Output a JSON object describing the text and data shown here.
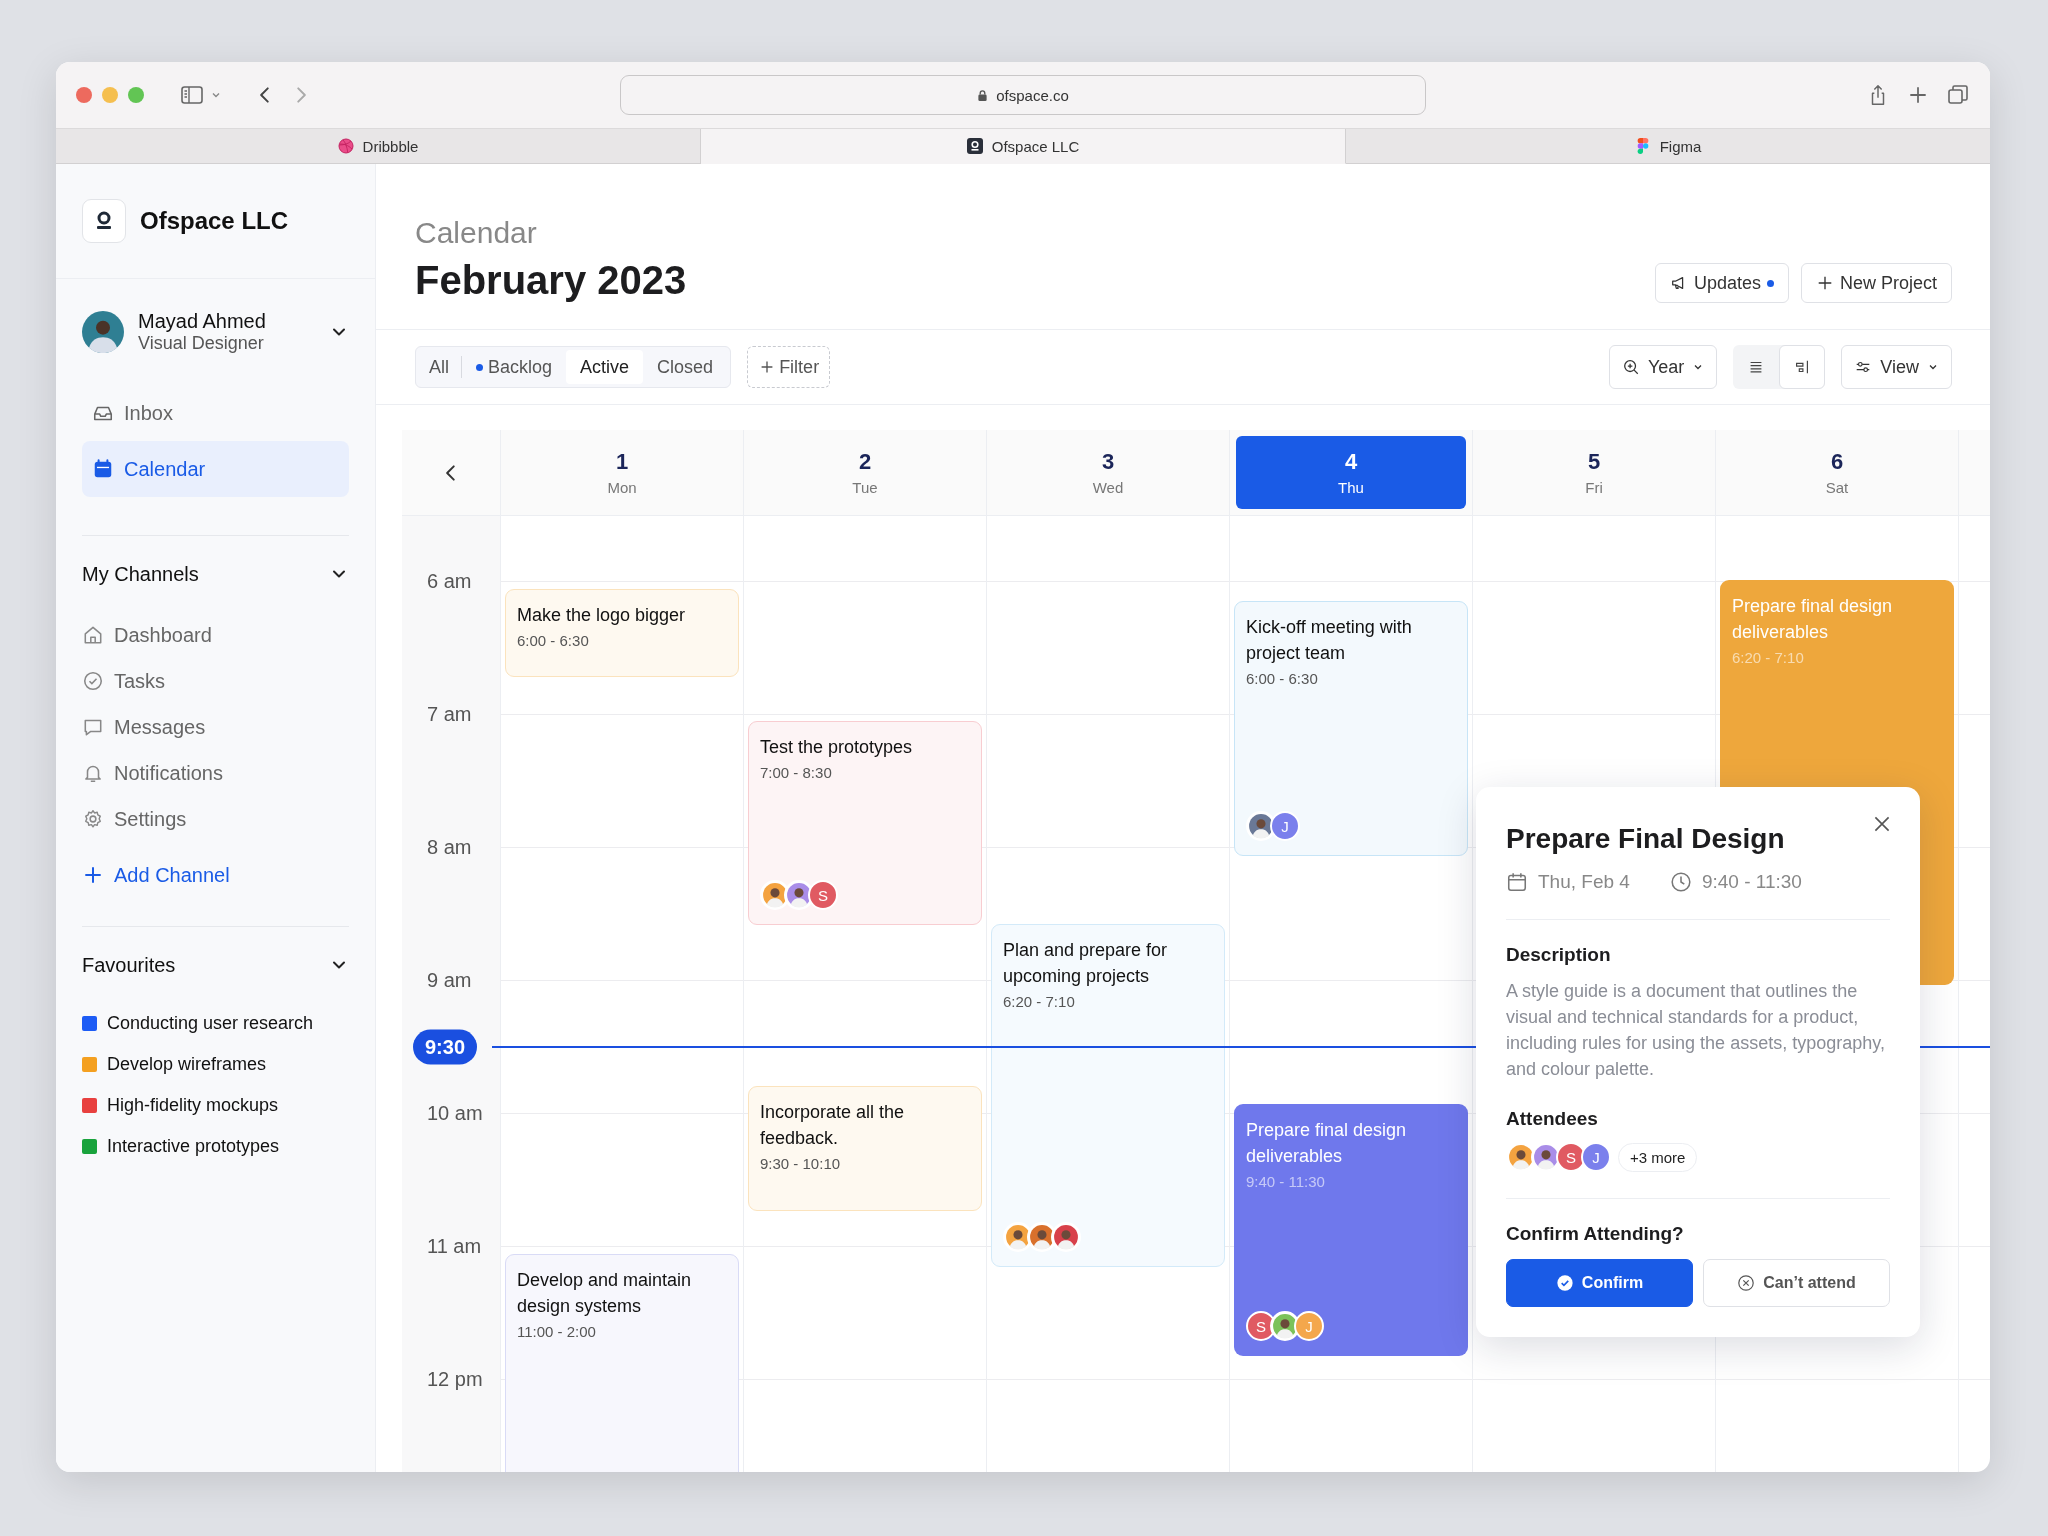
{
  "browser": {
    "url": "ofspace.co",
    "tabs": [
      {
        "label": "Dribbble",
        "selected": false
      },
      {
        "label": "Ofspace LLC",
        "selected": true
      },
      {
        "label": "Figma",
        "selected": false
      }
    ]
  },
  "sidebar": {
    "brand": "Ofspace LLC",
    "user": {
      "name": "Mayad Ahmed",
      "role": "Visual Designer"
    },
    "nav": [
      {
        "label": "Inbox",
        "selected": false
      },
      {
        "label": "Calendar",
        "selected": true
      }
    ],
    "channels": {
      "title": "My Channels",
      "expanded": true,
      "items": [
        "Dashboard",
        "Tasks",
        "Messages",
        "Notifications",
        "Settings"
      ],
      "add": "Add Channel"
    },
    "favourites": {
      "title": "Favourites",
      "expanded": true,
      "items": [
        {
          "label": "Conducting user research",
          "color": "#1d5cf5"
        },
        {
          "label": "Develop wireframes",
          "color": "#f4a020"
        },
        {
          "label": "High-fidelity mockups",
          "color": "#e8403f"
        },
        {
          "label": "Interactive prototypes",
          "color": "#19a33c"
        }
      ]
    }
  },
  "header": {
    "section": "Calendar",
    "title": "February 2023",
    "buttons": [
      {
        "label": "Updates",
        "kind": "updates",
        "badge": true
      },
      {
        "label": "New Project",
        "kind": "new",
        "badge": false
      }
    ]
  },
  "filters": {
    "segments": [
      {
        "label": "All",
        "selected": false,
        "dot": false
      },
      {
        "label": "Backlog",
        "selected": false,
        "dot": true
      },
      {
        "label": "Active",
        "selected": true,
        "dot": false
      },
      {
        "label": "Closed",
        "selected": false,
        "dot": false
      }
    ],
    "add_filter": "Filter",
    "range": "Year",
    "layouts": [
      {
        "selected": false
      },
      {
        "selected": true
      }
    ],
    "view": "View"
  },
  "calendar": {
    "now": "9:30",
    "hours": [
      "6 am",
      "7 am",
      "8 am",
      "9 am",
      "10 am",
      "11 am",
      "12 pm"
    ],
    "days": [
      {
        "number": "1",
        "weekday": "Mon",
        "selected": false,
        "events": [
          {
            "title": "Make the logo bigger",
            "time": "6:00 - 6:30",
            "kind": "soft",
            "color": "#fbe3bd"
          },
          {
            "title": "Develop and maintain design systems",
            "time": "11:00 - 2:00",
            "kind": "soft",
            "color": "#d9dbf6"
          }
        ]
      },
      {
        "number": "2",
        "weekday": "Tue",
        "selected": false,
        "events": [
          {
            "title": "Test the prototypes",
            "time": "7:00 - 8:30",
            "kind": "soft",
            "color": "#f8cdd1",
            "attendees": [
              {
                "kind": "photo",
                "color": "#f4a340"
              },
              {
                "kind": "photo",
                "color": "#a98de8"
              },
              {
                "kind": "letter",
                "label": "S",
                "color": "#e05a62"
              }
            ]
          },
          {
            "title": "Incorporate all the feedback.",
            "time": "9:30 - 10:10",
            "kind": "soft",
            "color": "#fbe3bd"
          }
        ]
      },
      {
        "number": "3",
        "weekday": "Wed",
        "selected": false,
        "events": [
          {
            "title": "Plan and prepare for upcoming projects",
            "time": "6:20 - 7:10",
            "kind": "soft",
            "color": "#d3eaf9",
            "attendees": [
              {
                "kind": "photo",
                "color": "#f4a340"
              },
              {
                "kind": "photo",
                "color": "#d9702c"
              },
              {
                "kind": "photo",
                "color": "#d8404a"
              }
            ]
          }
        ]
      },
      {
        "number": "4",
        "weekday": "Thu",
        "selected": true,
        "events": [
          {
            "title": "Kick-off meeting with project team",
            "time": "6:00 - 6:30",
            "kind": "soft",
            "color": "#c7e5f7",
            "attendees": [
              {
                "kind": "photo",
                "color": "#6a7896"
              },
              {
                "kind": "letter",
                "label": "J",
                "color": "#7b80ec"
              }
            ]
          },
          {
            "title": "Prepare final design deliverables",
            "time": "9:40 - 11:30",
            "kind": "solid",
            "color": "#6f78ec",
            "attendees": [
              {
                "kind": "letter",
                "label": "S",
                "color": "#e05a62"
              },
              {
                "kind": "photo",
                "color": "#7cc25a"
              },
              {
                "kind": "letter",
                "label": "J",
                "color": "#f4a74c"
              }
            ]
          }
        ]
      },
      {
        "number": "5",
        "weekday": "Fri",
        "selected": false
      },
      {
        "number": "6",
        "weekday": "Sat",
        "selected": false,
        "events": [
          {
            "title": "Prepare final design deliverables",
            "time": "6:20 - 7:10",
            "kind": "solid",
            "color": "#eea73c"
          }
        ]
      }
    ]
  },
  "popup": {
    "title": "Prepare Final Design",
    "date": "Thu, Feb 4",
    "time": "9:40 - 11:30",
    "description_label": "Description",
    "description": "A style guide is a document that outlines the visual and technical standards for a product, including rules for using the assets, typography, and colour palette.",
    "attendees_label": "Attendees",
    "attendees": [
      {
        "kind": "photo",
        "color": "#f4a340"
      },
      {
        "kind": "photo",
        "color": "#a98de8"
      },
      {
        "kind": "letter",
        "label": "S",
        "color": "#e05a62"
      },
      {
        "kind": "letter",
        "label": "J",
        "color": "#7b80ec"
      }
    ],
    "more": "+3 more",
    "confirm_label": "Confirm Attending?",
    "buttons": [
      {
        "label": "Confirm",
        "kind": "primary"
      },
      {
        "label": "Can’t attend",
        "kind": "secondary"
      }
    ]
  }
}
